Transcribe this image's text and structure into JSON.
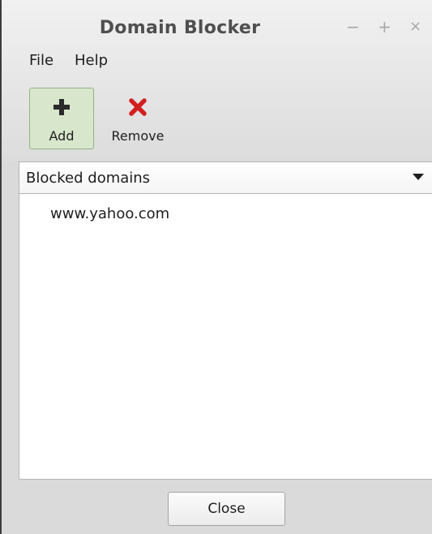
{
  "window": {
    "title": "Domain Blocker",
    "controls": {
      "minimize": "−",
      "maximize": "+",
      "close": "×"
    }
  },
  "menubar": {
    "items": [
      {
        "label": "File"
      },
      {
        "label": "Help"
      }
    ]
  },
  "toolbar": {
    "add": {
      "label": "Add",
      "icon": "plus-icon"
    },
    "remove": {
      "label": "Remove",
      "icon": "red-x-icon"
    }
  },
  "combo": {
    "selected": "Blocked domains"
  },
  "list": {
    "items": [
      "www.yahoo.com"
    ]
  },
  "footer": {
    "close_label": "Close"
  },
  "colors": {
    "add_button_bg": "#d8e6cc",
    "add_button_border": "#93b383",
    "remove_icon": "#d21f1f",
    "title_text": "#4f4f4f"
  }
}
